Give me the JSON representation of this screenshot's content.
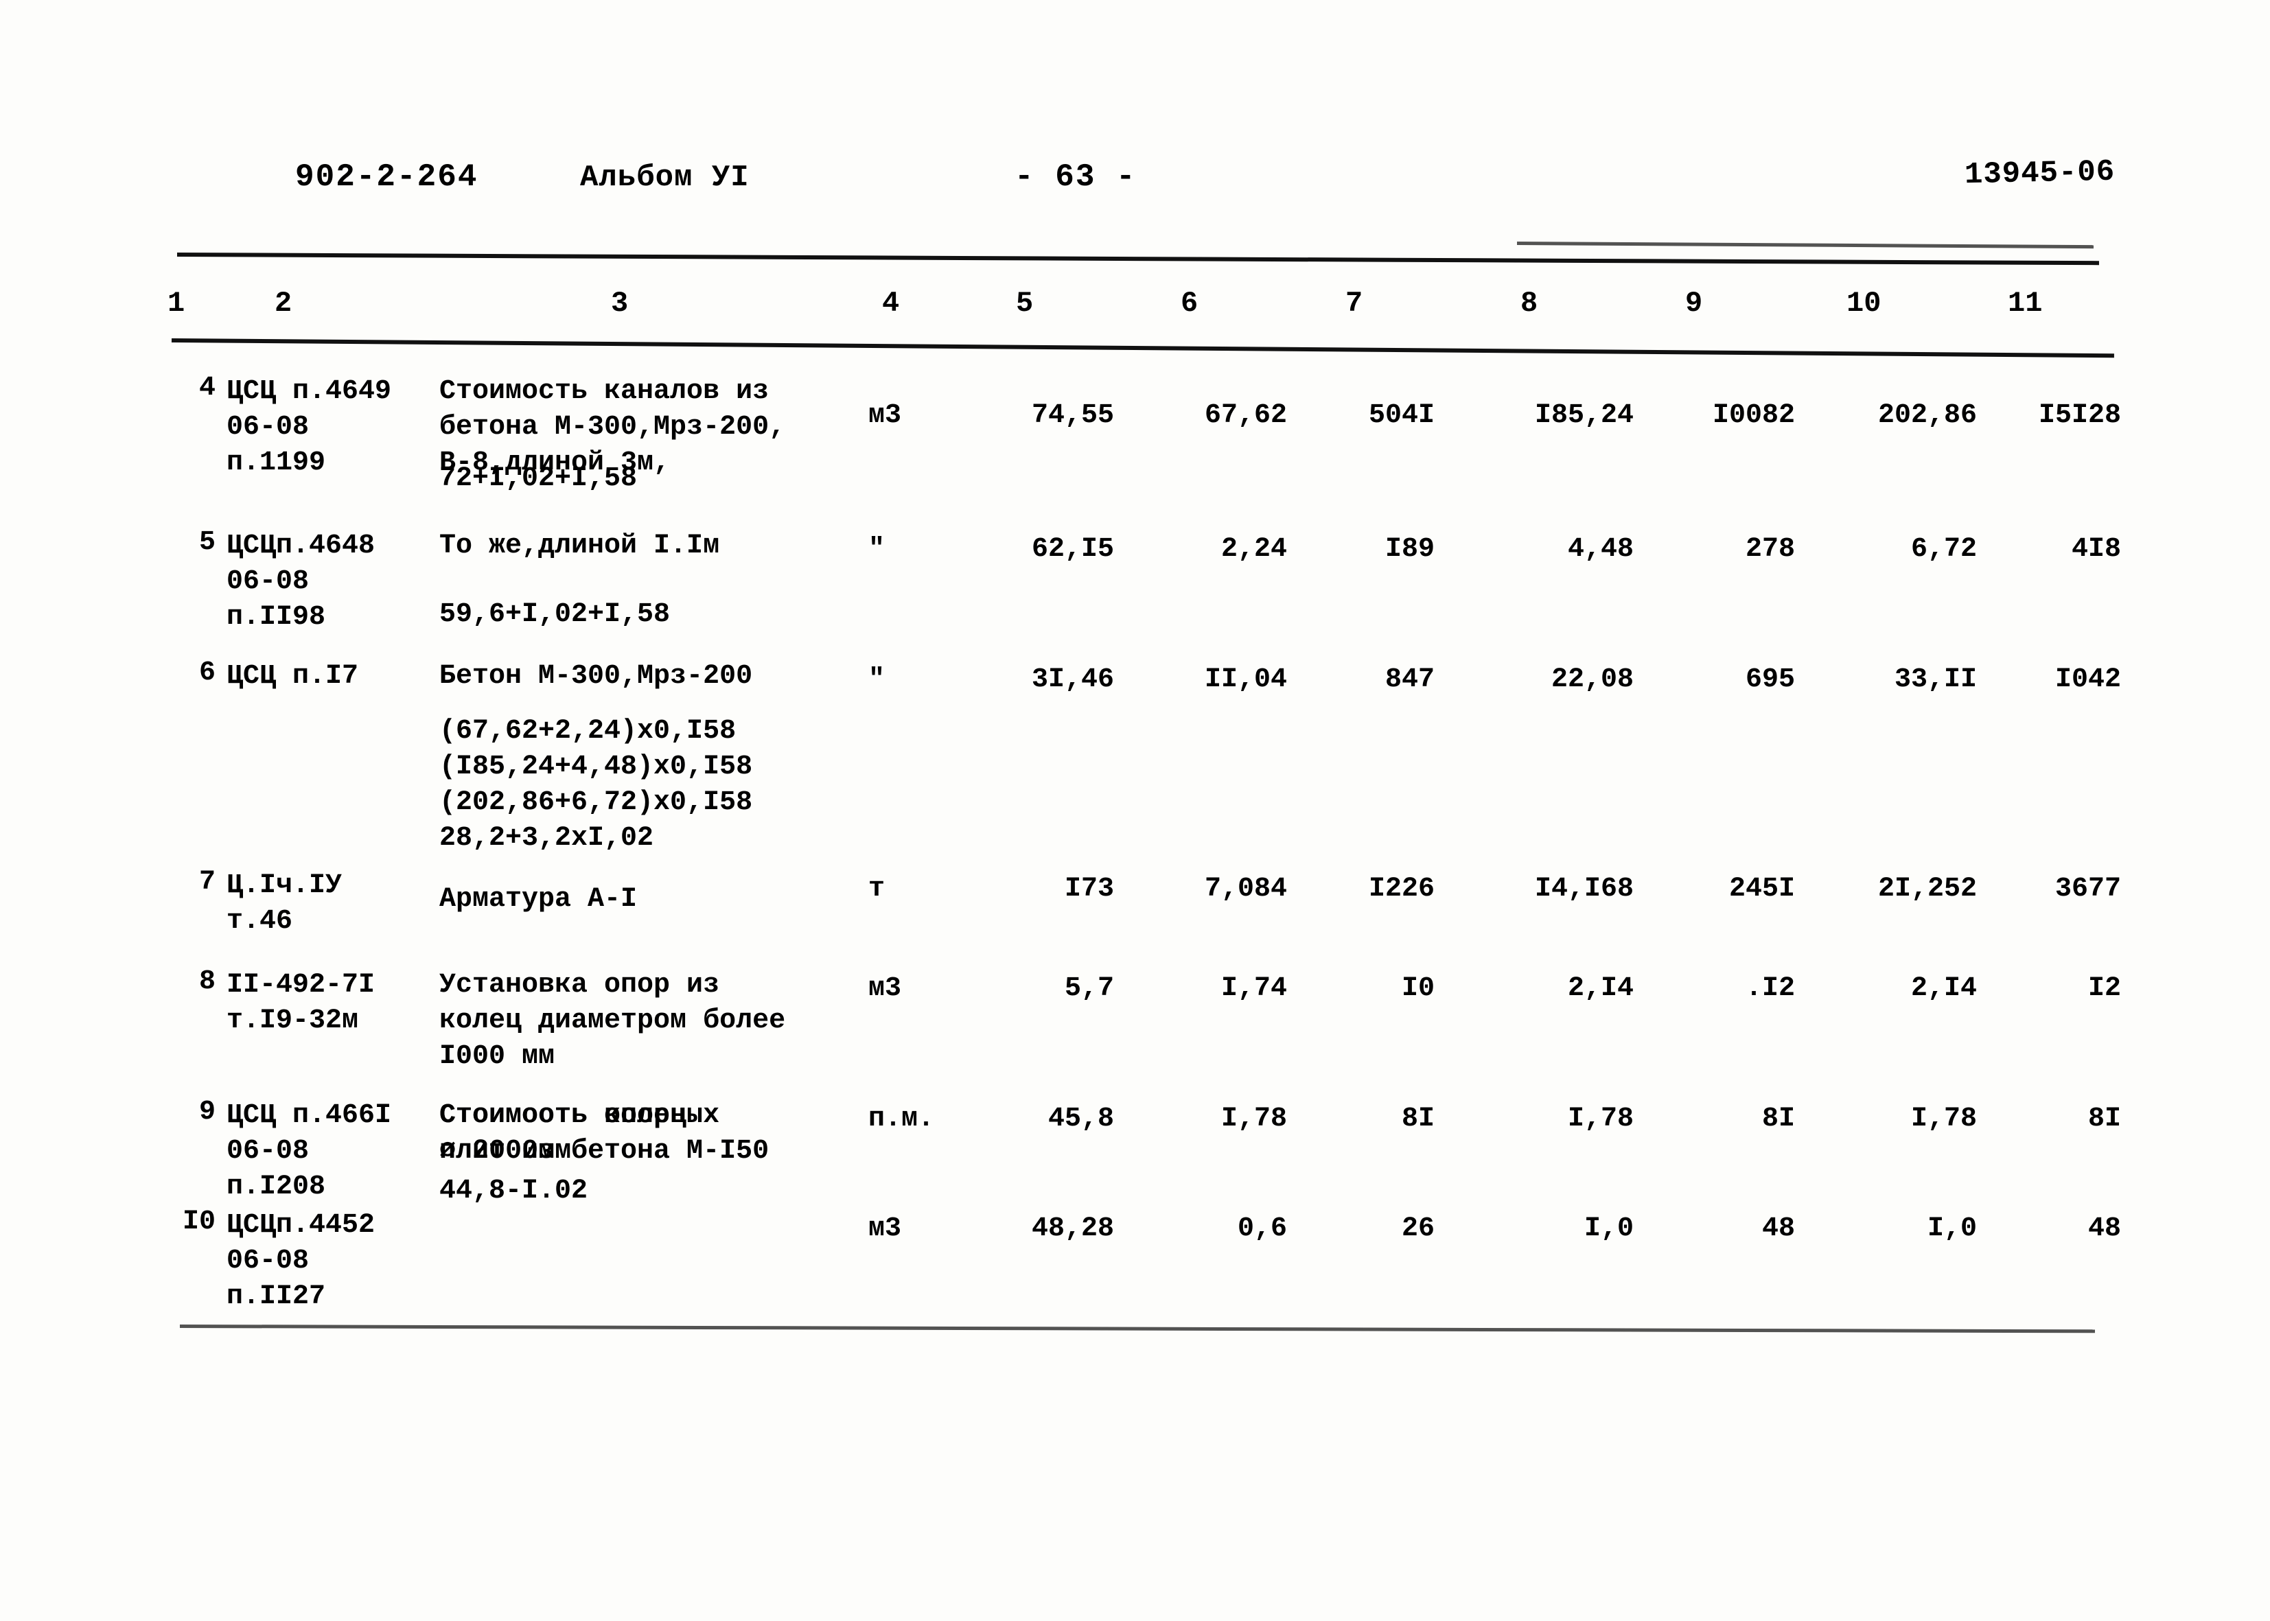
{
  "header": {
    "drawing_code": "902-2-264",
    "album": "Альбом УI",
    "page_number": "- 63 -",
    "stamp": "13945-06"
  },
  "table": {
    "column_headers": [
      "1",
      "2",
      "3",
      "4",
      "5",
      "6",
      "7",
      "8",
      "9",
      "10",
      "11"
    ],
    "rows": [
      {
        "num": "4",
        "justification": "ЦСЦ п.4649\n06-08\nп.1199",
        "description": "Стоимость каналов из\nбетона М-300,Мрз-200,\nВ-8,длиной 3м,",
        "calc": "72+I,02+I,58",
        "unit": "м3",
        "c5": "74,55",
        "c6": "67,62",
        "c7": "504I",
        "c8": "I85,24",
        "c9": "I0082",
        "c10": "202,86",
        "c11": "I5I28"
      },
      {
        "num": "5",
        "justification": "ЦСЦп.4648\n06-08\nп.II98",
        "description": "То же,длиной I.Iм",
        "calc": "59,6+I,02+I,58",
        "unit": "\"",
        "c5": "62,I5",
        "c6": "2,24",
        "c7": "I89",
        "c8": "4,48",
        "c9": "278",
        "c10": "6,72",
        "c11": "4I8"
      },
      {
        "num": "6",
        "justification": "ЦСЦ п.I7",
        "description": "Бетон М-300,Мрз-200",
        "calc": "(67,62+2,24)х0,I58\n(I85,24+4,48)х0,I58\n(202,86+6,72)х0,I58\n28,2+3,2хI,02",
        "unit": "\"",
        "c5": "3I,46",
        "c6": "II,04",
        "c7": "847",
        "c8": "22,08",
        "c9": "695",
        "c10": "33,II",
        "c11": "I042"
      },
      {
        "num": "7",
        "justification": "Ц.Iч.IУ\nт.46",
        "description": "Арматура А-I",
        "calc": "",
        "unit": "т",
        "c5": "I73",
        "c6": "7,084",
        "c7": "I226",
        "c8": "I4,I68",
        "c9": "245I",
        "c10": "2I,252",
        "c11": "3677"
      },
      {
        "num": "8",
        "justification": "II-492-7I\nт.I9-32м",
        "description": "Установка опор из\nколец диаметром более\nI000 мм",
        "calc": "",
        "unit": "м3",
        "c5": "5,7",
        "c6": "I,74",
        "c7": "I0",
        "c8": "2,I4",
        "c9": ".I2",
        "c10": "2,I4",
        "c11": "I2"
      },
      {
        "num": "9",
        "justification": "ЦСЦ п.466I\n06-08\nп.I208",
        "description": "Стоимость колец\n⌀ 2000мм",
        "calc": "",
        "unit": "п.м.",
        "c5": "45,8",
        "c6": "I,78",
        "c7": "8I",
        "c8": "I,78",
        "c9": "8I",
        "c10": "I,78",
        "c11": "8I"
      },
      {
        "num": "I0",
        "justification": "ЦСЦп.4452\n06-08\nп.II27",
        "description": "Стоимооть опорных\nплит из бетона М-I50",
        "calc": "44,8-I.02",
        "unit": "м3",
        "c5": "48,28",
        "c6": "0,6",
        "c7": "26",
        "c8": "I,0",
        "c9": "48",
        "c10": "I,0",
        "c11": "48"
      }
    ]
  }
}
